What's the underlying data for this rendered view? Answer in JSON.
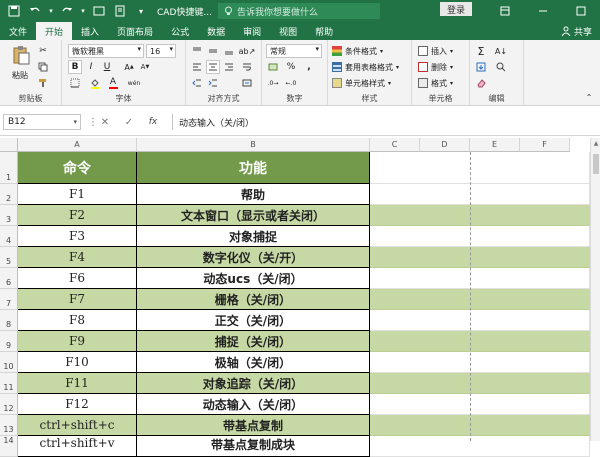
{
  "title_bar": {
    "title": "CAD快捷键...",
    "tell_me": "告诉我你想要做什么",
    "login": "登录"
  },
  "ribbon_tabs": [
    "文件",
    "开始",
    "插入",
    "页面布局",
    "公式",
    "数据",
    "审阅",
    "视图",
    "帮助"
  ],
  "active_tab": "开始",
  "share_label": "共享",
  "clipboard": {
    "paste": "粘贴",
    "group": "剪贴板"
  },
  "font": {
    "name": "微软雅黑",
    "size": "16",
    "bold": "B",
    "italic": "I",
    "underline": "U",
    "group": "字体",
    "font_color_letter": "A",
    "wen": "wén"
  },
  "alignment": {
    "group": "对齐方式"
  },
  "number": {
    "format": "常规",
    "group": "数字",
    "percent": "%",
    "comma": ","
  },
  "styles": {
    "conditional": "条件格式",
    "table": "套用表格格式",
    "cell": "单元格样式",
    "group": "样式"
  },
  "cells": {
    "insert": "插入",
    "delete": "删除",
    "format": "格式",
    "group": "单元格"
  },
  "editing": {
    "group": "编辑",
    "sum": "Σ"
  },
  "formula_bar": {
    "cell_ref": "B12",
    "fx": "fx",
    "content": "动态输入（关/闭）"
  },
  "columns": [
    "A",
    "B",
    "C",
    "D",
    "E",
    "F"
  ],
  "rows": [
    {
      "n": "1",
      "a": "命令",
      "b": "功能"
    },
    {
      "n": "2",
      "a": "F1",
      "b": "帮助"
    },
    {
      "n": "3",
      "a": "F2",
      "b": "文本窗口（显示或者关闭）"
    },
    {
      "n": "4",
      "a": "F3",
      "b": "对象捕捉"
    },
    {
      "n": "5",
      "a": "F4",
      "b": "数字化仪（关/开）"
    },
    {
      "n": "6",
      "a": "F6",
      "b": "动态ucs（关/闭）"
    },
    {
      "n": "7",
      "a": "F7",
      "b": "栅格（关/闭）"
    },
    {
      "n": "8",
      "a": "F8",
      "b": "正交（关/闭）"
    },
    {
      "n": "9",
      "a": "F9",
      "b": "捕捉（关/闭）"
    },
    {
      "n": "10",
      "a": "F10",
      "b": "极轴（关/闭）"
    },
    {
      "n": "11",
      "a": "F11",
      "b": "对象追踪（关/闭）"
    },
    {
      "n": "12",
      "a": "F12",
      "b": "动态输入（关/闭）"
    },
    {
      "n": "13",
      "a": "ctrl+shift+c",
      "b": "带基点复制"
    },
    {
      "n": "14",
      "a": "ctrl+shift+v",
      "b": "带基点复制成块"
    }
  ],
  "colors": {
    "brand": "#217346",
    "header_fill": "#739a4a",
    "band_fill": "#c6d9a4"
  }
}
